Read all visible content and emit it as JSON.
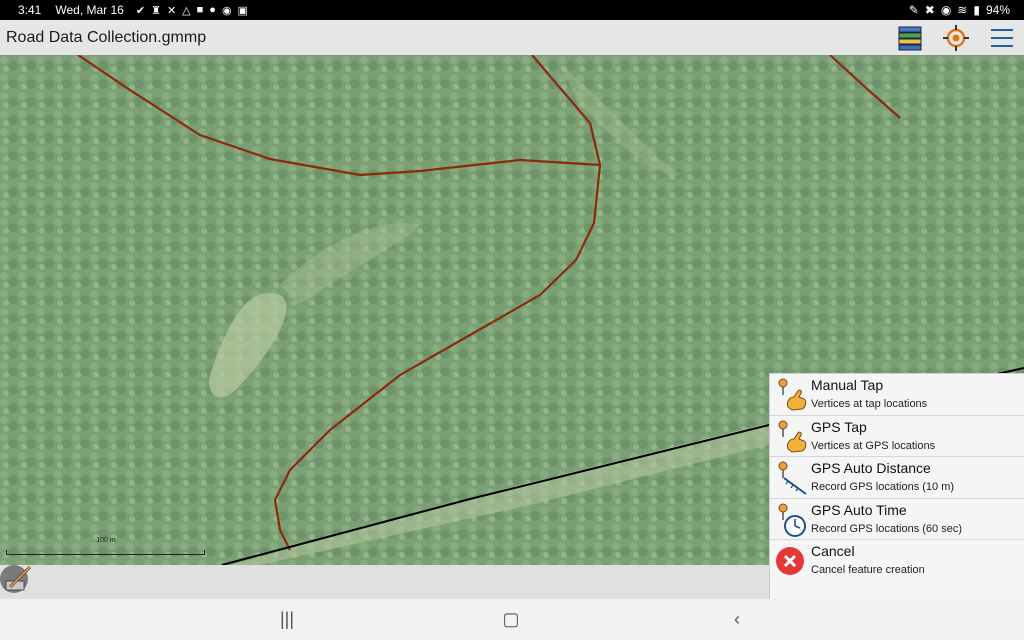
{
  "status_bar": {
    "time": "3:41",
    "date": "Wed, Mar 16",
    "battery": "94%",
    "left_icons": [
      "check-icon",
      "chess-icon",
      "tools-icon",
      "triangle-icon",
      "lock-icon",
      "bulb-icon",
      "location-icon",
      "box-icon"
    ],
    "right_icons": [
      "pen-icon",
      "mute-icon",
      "location-icon",
      "wifi-icon",
      "signal-icon"
    ]
  },
  "app_bar": {
    "title": "Road Data Collection.gmmp",
    "actions": [
      "layers-icon",
      "gps-target-icon",
      "menu-icon"
    ]
  },
  "map": {
    "scale_label": "100 m",
    "colors": {
      "road_line": "#8b2a0e",
      "black_line": "#000000"
    }
  },
  "menu": {
    "items": [
      {
        "label": "Manual Tap",
        "sub": "Vertices at tap locations",
        "icon": "tap-hand-icon"
      },
      {
        "label": "GPS Tap",
        "sub": "Vertices at GPS locations",
        "icon": "gps-tap-icon"
      },
      {
        "label": "GPS Auto Distance",
        "sub": "Record GPS locations (10 m)",
        "icon": "distance-icon"
      },
      {
        "label": "GPS Auto Time",
        "sub": "Record GPS locations (60 sec)",
        "icon": "clock-icon"
      },
      {
        "label": "Cancel",
        "sub": "Cancel feature creation",
        "icon": "cancel-icon"
      }
    ]
  },
  "nav_bar": {
    "recents": "|||",
    "home": "▢",
    "back": "‹"
  }
}
